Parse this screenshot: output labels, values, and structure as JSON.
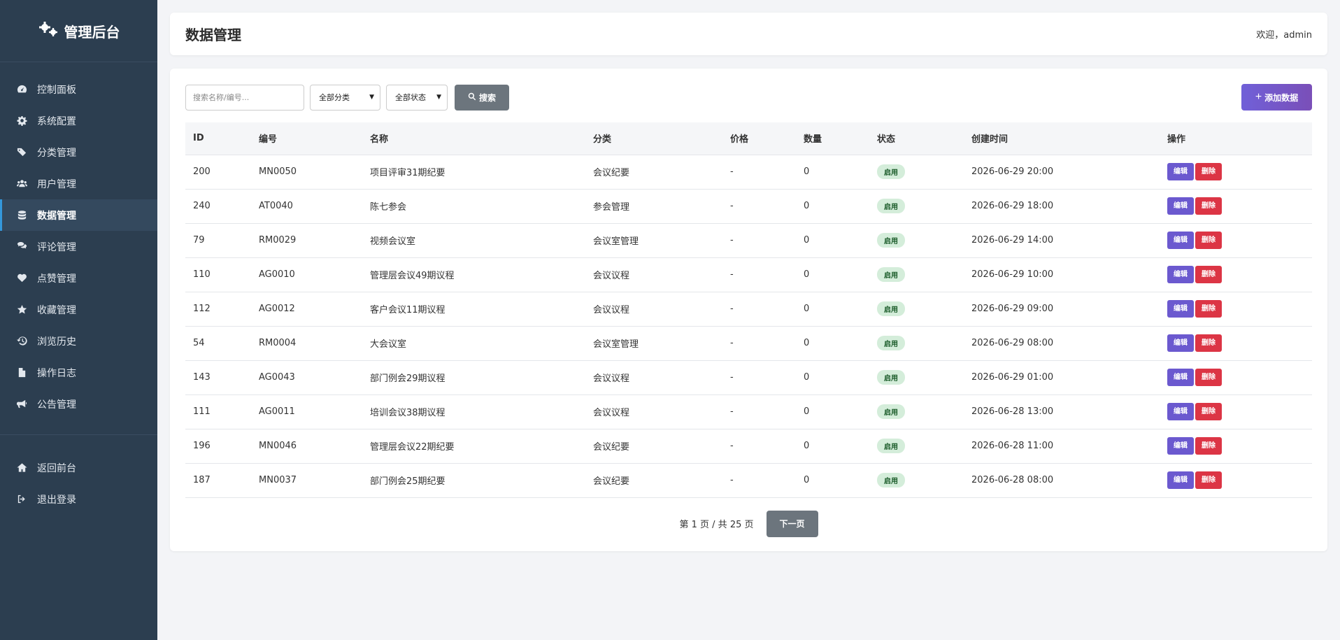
{
  "sidebar": {
    "brand": "管理后台",
    "items": [
      {
        "label": "控制面板",
        "icon": "dashboard-icon"
      },
      {
        "label": "系统配置",
        "icon": "gear-icon"
      },
      {
        "label": "分类管理",
        "icon": "tags-icon"
      },
      {
        "label": "用户管理",
        "icon": "users-icon"
      },
      {
        "label": "数据管理",
        "icon": "database-icon",
        "active": true
      },
      {
        "label": "评论管理",
        "icon": "comments-icon"
      },
      {
        "label": "点赞管理",
        "icon": "heart-icon"
      },
      {
        "label": "收藏管理",
        "icon": "star-icon"
      },
      {
        "label": "浏览历史",
        "icon": "history-icon"
      },
      {
        "label": "操作日志",
        "icon": "file-icon"
      },
      {
        "label": "公告管理",
        "icon": "bullhorn-icon"
      }
    ],
    "bottom_items": [
      {
        "label": "返回前台",
        "icon": "home-icon"
      },
      {
        "label": "退出登录",
        "icon": "logout-icon"
      }
    ]
  },
  "header": {
    "title": "数据管理",
    "welcome": "欢迎，admin"
  },
  "toolbar": {
    "search_placeholder": "搜索名称/编号...",
    "category_select": "全部分类",
    "status_select": "全部状态",
    "search_label": "搜索",
    "add_label": "添加数据"
  },
  "table": {
    "columns": [
      "ID",
      "编号",
      "名称",
      "分类",
      "价格",
      "数量",
      "状态",
      "创建时间",
      "操作"
    ],
    "rows": [
      {
        "id": "200",
        "code": "MN0050",
        "name": "项目评审31期纪要",
        "category": "会议纪要",
        "price": "-",
        "qty": "0",
        "status": "启用",
        "created": "2026-06-29 20:00"
      },
      {
        "id": "240",
        "code": "AT0040",
        "name": "陈七参会",
        "category": "参会管理",
        "price": "-",
        "qty": "0",
        "status": "启用",
        "created": "2026-06-29 18:00"
      },
      {
        "id": "79",
        "code": "RM0029",
        "name": "视频会议室",
        "category": "会议室管理",
        "price": "-",
        "qty": "0",
        "status": "启用",
        "created": "2026-06-29 14:00"
      },
      {
        "id": "110",
        "code": "AG0010",
        "name": "管理层会议49期议程",
        "category": "会议议程",
        "price": "-",
        "qty": "0",
        "status": "启用",
        "created": "2026-06-29 10:00"
      },
      {
        "id": "112",
        "code": "AG0012",
        "name": "客户会议11期议程",
        "category": "会议议程",
        "price": "-",
        "qty": "0",
        "status": "启用",
        "created": "2026-06-29 09:00"
      },
      {
        "id": "54",
        "code": "RM0004",
        "name": "大会议室",
        "category": "会议室管理",
        "price": "-",
        "qty": "0",
        "status": "启用",
        "created": "2026-06-29 08:00"
      },
      {
        "id": "143",
        "code": "AG0043",
        "name": "部门例会29期议程",
        "category": "会议议程",
        "price": "-",
        "qty": "0",
        "status": "启用",
        "created": "2026-06-29 01:00"
      },
      {
        "id": "111",
        "code": "AG0011",
        "name": "培训会议38期议程",
        "category": "会议议程",
        "price": "-",
        "qty": "0",
        "status": "启用",
        "created": "2026-06-28 13:00"
      },
      {
        "id": "196",
        "code": "MN0046",
        "name": "管理层会议22期纪要",
        "category": "会议纪要",
        "price": "-",
        "qty": "0",
        "status": "启用",
        "created": "2026-06-28 11:00"
      },
      {
        "id": "187",
        "code": "MN0037",
        "name": "部门例会25期纪要",
        "category": "会议纪要",
        "price": "-",
        "qty": "0",
        "status": "启用",
        "created": "2026-06-28 08:00"
      }
    ],
    "edit_label": "编辑",
    "delete_label": "删除"
  },
  "pager": {
    "text": "第 1 页 / 共 25 页",
    "next_label": "下一页"
  },
  "colors": {
    "sidebar_bg": "#2c3e50",
    "active_accent": "#3498db",
    "edit_button": "#6b59cf",
    "delete_button": "#dc3545",
    "status_badge": "#d4edda"
  }
}
